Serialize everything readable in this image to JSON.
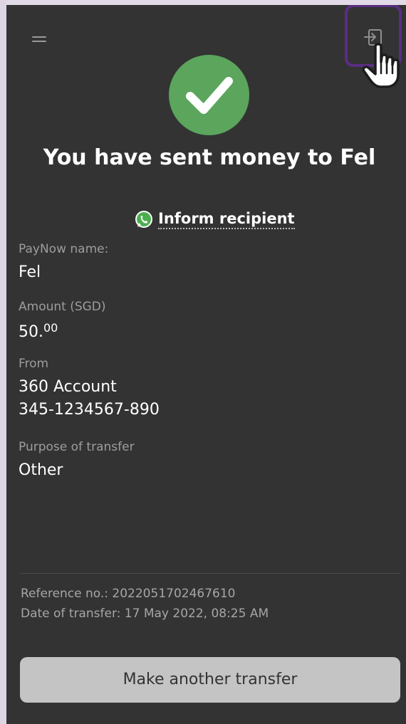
{
  "header": {
    "menu_icon": "menu-icon",
    "logout_icon": "logout-icon",
    "pointer_icon": "hand-pointer-icon",
    "highlight_color": "#5b2d83"
  },
  "status": {
    "icon": "checkmark-icon",
    "icon_color": "#5ba55c",
    "headline": "You have sent money to Fel"
  },
  "inform": {
    "icon": "whatsapp-icon",
    "label": "Inform recipient"
  },
  "details": {
    "paynow_label": "PayNow name:",
    "paynow_value": "Fel",
    "amount_label": "Amount (SGD)",
    "amount_whole": "50.",
    "amount_cents": "00",
    "from_label": "From",
    "from_account": "360 Account",
    "from_number": "345-1234567-890",
    "purpose_label": "Purpose of transfer",
    "purpose_value": "Other"
  },
  "footer": {
    "reference": "Reference no.: 2022051702467610",
    "date": "Date of transfer: 17 May 2022, 08:25 AM",
    "button_label": "Make another transfer"
  }
}
